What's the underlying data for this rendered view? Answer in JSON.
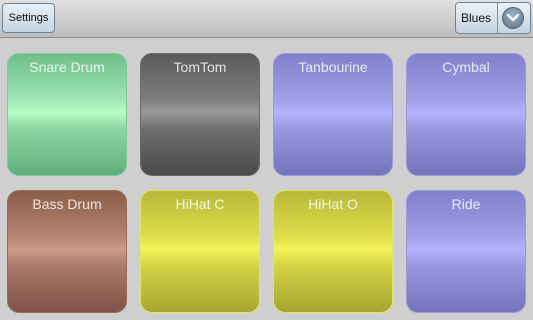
{
  "toolbar": {
    "settings_label": "Settings",
    "style_value": "Blues"
  },
  "pads": [
    {
      "label": "Snare Drum",
      "color": "green"
    },
    {
      "label": "TomTom",
      "color": "gray"
    },
    {
      "label": "Tanbourine",
      "color": "purple"
    },
    {
      "label": "Cymbal",
      "color": "purple"
    },
    {
      "label": "Bass Drum",
      "color": "brown"
    },
    {
      "label": "HiHat C",
      "color": "yellow"
    },
    {
      "label": "HiHat O",
      "color": "yellow"
    },
    {
      "label": "Ride",
      "color": "purple"
    }
  ],
  "colors": {
    "green": "#b8ffc6",
    "gray": "#7e7e7e",
    "purple": "#b4b4ff",
    "brown": "#cc9c86",
    "yellow": "#f3f35a"
  },
  "icons": {
    "dropdown": "chevron-down-icon"
  }
}
